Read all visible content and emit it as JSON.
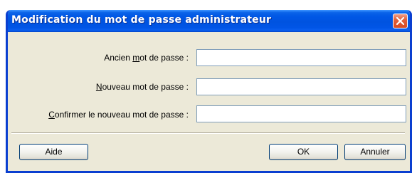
{
  "window": {
    "title": "Modification du mot de passe administrateur"
  },
  "form": {
    "old_password": {
      "label_pre": "Ancien ",
      "label_mnemonic": "m",
      "label_post": "ot de passe :",
      "value": ""
    },
    "new_password": {
      "label_pre": "",
      "label_mnemonic": "N",
      "label_post": "ouveau mot de passe :",
      "value": ""
    },
    "confirm_password": {
      "label_pre": "",
      "label_mnemonic": "C",
      "label_post": "onfirmer le nouveau mot de passe :",
      "value": ""
    }
  },
  "buttons": {
    "help": "Aide",
    "ok": "OK",
    "cancel": "Annuler"
  },
  "colors": {
    "titlebar": "#0055e5",
    "frame": "#0a3fd0",
    "dialog_bg": "#ece9d8",
    "close_button": "#e0603a",
    "field_border": "#7f9db9"
  },
  "icons": {
    "close": "close-x-icon"
  }
}
